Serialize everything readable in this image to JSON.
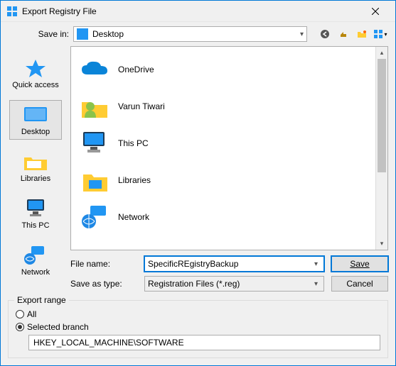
{
  "window": {
    "title": "Export Registry File"
  },
  "save_in": {
    "label": "Save in:",
    "value": "Desktop"
  },
  "toolbar_icons": {
    "back": "back-icon",
    "up": "up-icon",
    "new_folder": "new-folder-icon",
    "views": "views-icon"
  },
  "places": [
    {
      "id": "quick-access",
      "label": "Quick access",
      "selected": false
    },
    {
      "id": "desktop",
      "label": "Desktop",
      "selected": true
    },
    {
      "id": "libraries",
      "label": "Libraries",
      "selected": false
    },
    {
      "id": "this-pc",
      "label": "This PC",
      "selected": false
    },
    {
      "id": "network",
      "label": "Network",
      "selected": false
    }
  ],
  "files": [
    {
      "id": "onedrive",
      "label": "OneDrive"
    },
    {
      "id": "user",
      "label": "Varun Tiwari"
    },
    {
      "id": "this-pc",
      "label": "This PC"
    },
    {
      "id": "libraries",
      "label": "Libraries"
    },
    {
      "id": "network",
      "label": "Network"
    }
  ],
  "filename": {
    "label": "File name:",
    "value": "SpecificREgistryBackup"
  },
  "save_as_type": {
    "label": "Save as type:",
    "value": "Registration Files (*.reg)"
  },
  "buttons": {
    "save": "Save",
    "cancel": "Cancel"
  },
  "export_range": {
    "legend": "Export range",
    "all_label": "All",
    "selected_label": "Selected branch",
    "selected": "selected",
    "branch_path": "HKEY_LOCAL_MACHINE\\SOFTWARE"
  }
}
